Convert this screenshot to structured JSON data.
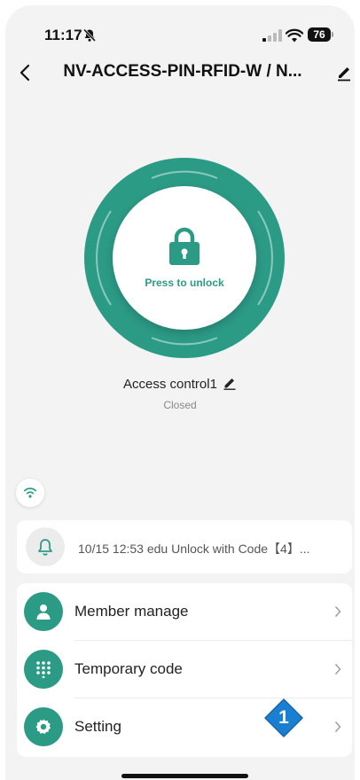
{
  "status_bar": {
    "time": "11:17",
    "battery": "76"
  },
  "nav": {
    "title": "NV-ACCESS-PIN-RFID-W / N..."
  },
  "lock": {
    "press_label": "Press to unlock"
  },
  "device": {
    "name": "Access control1",
    "status": "Closed"
  },
  "record": {
    "text": "10/15 12:53 edu  Unlock with Code【4】..."
  },
  "menu": {
    "items": [
      {
        "label": "Member manage",
        "icon": "person-icon"
      },
      {
        "label": "Temporary code",
        "icon": "keypad-icon"
      },
      {
        "label": "Setting",
        "icon": "gear-icon"
      }
    ]
  },
  "badge": {
    "label": "1"
  },
  "colors": {
    "accent": "#2c9b86",
    "badge": "#1a7fd1",
    "background": "#f3f3f4"
  }
}
